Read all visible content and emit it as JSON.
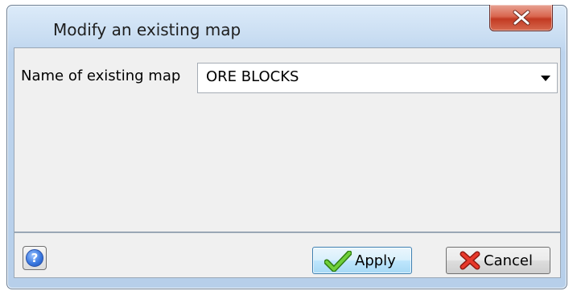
{
  "window": {
    "title": "Modify an existing map"
  },
  "form": {
    "map_label": "Name of existing map",
    "map_value": "ORE BLOCKS"
  },
  "footer": {
    "help_glyph": "?",
    "apply_label": "Apply",
    "cancel_label": "Cancel"
  },
  "icons": {
    "close": "close-x-icon",
    "help": "help-question-icon",
    "apply": "checkmark-icon",
    "cancel": "red-x-icon",
    "dropdown": "chevron-down-icon"
  },
  "colors": {
    "close_button": "#c8432b",
    "apply_check": "#4bab24",
    "cancel_x": "#d52a1f",
    "help_circle": "#3b79e0"
  }
}
